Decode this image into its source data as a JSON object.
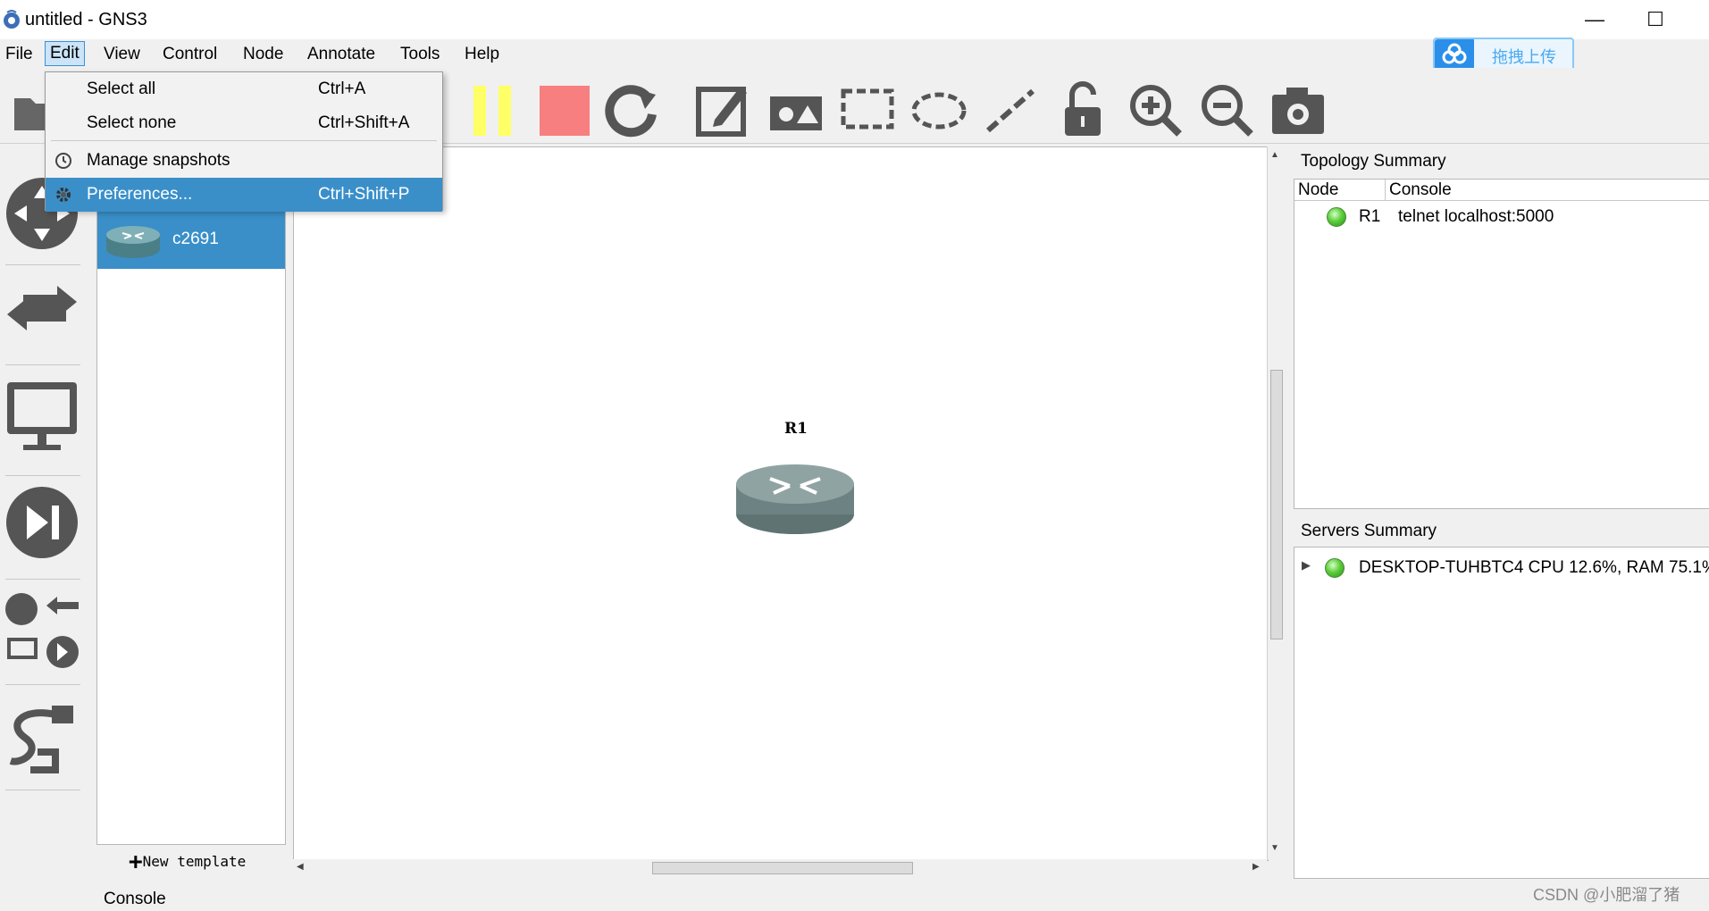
{
  "window": {
    "title": "untitled - GNS3",
    "minimize": "—",
    "maximize": "☐"
  },
  "menubar": {
    "items": [
      "File",
      "Edit",
      "View",
      "Control",
      "Node",
      "Annotate",
      "Tools",
      "Help"
    ],
    "active": "Edit"
  },
  "upload_button": {
    "label": "拖拽上传"
  },
  "edit_menu": {
    "items": [
      {
        "label": "Select all",
        "shortcut": "Ctrl+A",
        "icon": ""
      },
      {
        "label": "Select none",
        "shortcut": "Ctrl+Shift+A",
        "icon": ""
      },
      {
        "label": "Manage snapshots",
        "shortcut": "",
        "icon": "clock-icon"
      },
      {
        "label": "Preferences...",
        "shortcut": "Ctrl+Shift+P",
        "icon": "gear-icon"
      }
    ],
    "highlighted": "Preferences..."
  },
  "device_list": {
    "selected": {
      "name": "c2691",
      "icon": "router-icon"
    },
    "new_template": "New template"
  },
  "canvas": {
    "node": {
      "label": "R1",
      "icon": "router-icon"
    }
  },
  "topology_summary": {
    "title": "Topology Summary",
    "columns": [
      "Node",
      "Console"
    ],
    "rows": [
      {
        "node": "R1",
        "console": "telnet localhost:5000",
        "status": "running"
      }
    ]
  },
  "servers_summary": {
    "title": "Servers Summary",
    "rows": [
      {
        "name": "DESKTOP-TUHBTC4 CPU 12.6%, RAM 75.1%",
        "status": "running"
      }
    ]
  },
  "console": {
    "label": "Console"
  },
  "watermark": "CSDN @小肥溜了猪",
  "colors": {
    "selection": "#3a8fc9",
    "status_green": "#5dce3c",
    "stop_red": "#f77f7f",
    "pause_yellow": "#ffff66"
  },
  "icons": [
    "folder-icon",
    "pause-icon",
    "stop-icon",
    "reload-icon",
    "edit-note-icon",
    "insert-picture-icon",
    "rectangle-icon",
    "ellipse-icon",
    "line-icon",
    "lock-icon",
    "zoom-in-icon",
    "zoom-out-icon",
    "screenshot-icon"
  ]
}
